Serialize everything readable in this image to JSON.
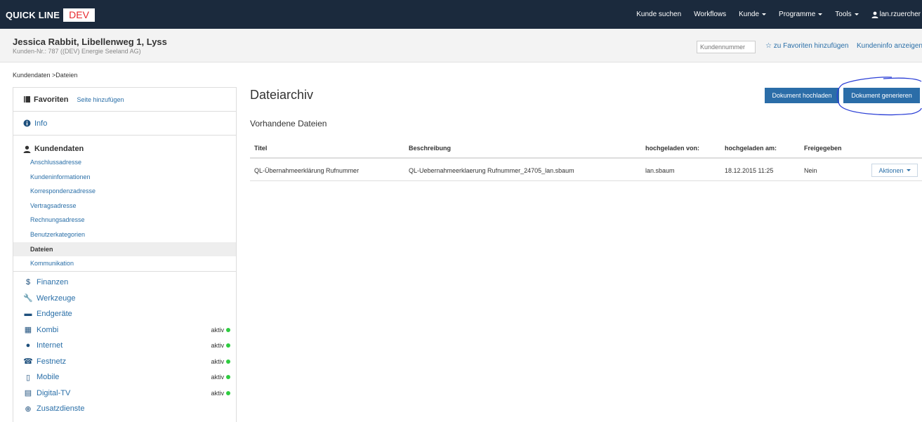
{
  "navbar": {
    "brand": "QUICK LINE",
    "env": "DEV",
    "items": [
      {
        "label": "Kunde suchen",
        "dropdown": false
      },
      {
        "label": "Workflows",
        "dropdown": false
      },
      {
        "label": "Kunde",
        "dropdown": true
      },
      {
        "label": "Programme",
        "dropdown": true
      },
      {
        "label": "Tools",
        "dropdown": true
      }
    ],
    "user": "lan.rzuercher"
  },
  "customer": {
    "name": "Jessica Rabbit, Libellenweg 1, Lyss",
    "sub": "Kunden-Nr.: 787 ((DEV) Energie Seeland AG)",
    "search_placeholder": "Kundennummer",
    "fav_link": "zu Favoriten hinzufügen",
    "info_link": "Kundeninfo anzeigen"
  },
  "breadcrumb": "Kundendaten >Dateien",
  "sidebar": {
    "favorites_title": "Favoriten",
    "favorites_add": "Seite hinzufügen",
    "info": "Info",
    "kundendaten_title": "Kundendaten",
    "kundendaten_items": [
      "Anschlussadresse",
      "Kundeninformationen",
      "Korrespondenzadresse",
      "Vertragsadresse",
      "Rechnungsadresse",
      "Benutzerkategorien",
      "Dateien",
      "Kommunikation"
    ],
    "active_item": "Dateien",
    "main_items": [
      {
        "label": "Finanzen",
        "icon": "dollar-icon",
        "status": ""
      },
      {
        "label": "Werkzeuge",
        "icon": "wrench-icon",
        "status": ""
      },
      {
        "label": "Endgeräte",
        "icon": "device-icon",
        "status": ""
      },
      {
        "label": "Kombi",
        "icon": "grid-icon",
        "status": "aktiv"
      },
      {
        "label": "Internet",
        "icon": "globe-icon",
        "status": "aktiv"
      },
      {
        "label": "Festnetz",
        "icon": "phone-icon",
        "status": "aktiv"
      },
      {
        "label": "Mobile",
        "icon": "mobile-icon",
        "status": "aktiv"
      },
      {
        "label": "Digital-TV",
        "icon": "film-icon",
        "status": "aktiv"
      },
      {
        "label": "Zusatzdienste",
        "icon": "plus-icon",
        "status": ""
      }
    ],
    "status_color": "#2ecc40"
  },
  "main": {
    "title": "Dateiarchiv",
    "upload_button": "Dokument hochladen",
    "generate_button": "Dokument generieren",
    "section_title": "Vorhandene Dateien",
    "columns": [
      "Titel",
      "Beschreibung",
      "hochgeladen von:",
      "hochgeladen am:",
      "Freigegeben"
    ],
    "rows": [
      {
        "titel": "QL-Übernahmeerklärung Rufnummer",
        "beschreibung": "QL-Uebernahmeerklaerung Rufnummer_24705_lan.sbaum",
        "von": "lan.sbaum",
        "am": "18.12.2015 11:25",
        "freigegeben": "Nein",
        "action": "Aktionen"
      }
    ]
  },
  "colors": {
    "navbar": "#1b2a3d",
    "primary": "#2b6da8",
    "link": "#2a6fa8",
    "annotation": "#2b3fd6"
  }
}
